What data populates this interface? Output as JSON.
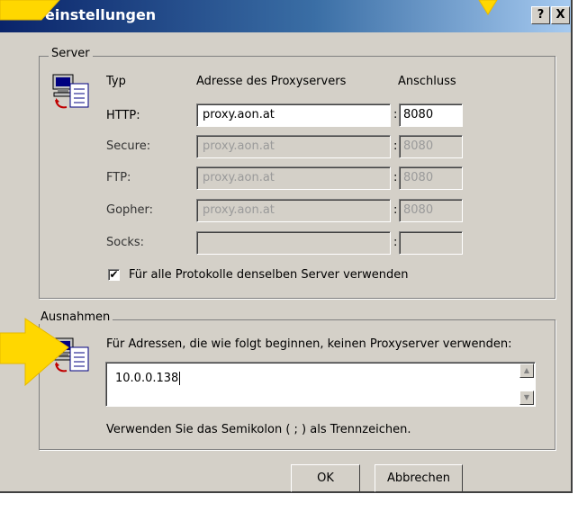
{
  "title": "Proxyeinstellungen",
  "title_visible": "einstellungen",
  "help_button": "?",
  "close_button": "X",
  "server": {
    "legend": "Server",
    "col_typ": "Typ",
    "col_address": "Adresse des Proxyservers",
    "col_port": "Anschluss",
    "rows": [
      {
        "label": "HTTP:",
        "address": "proxy.aon.at",
        "port": "8080",
        "enabled": true
      },
      {
        "label": "Secure:",
        "address": "proxy.aon.at",
        "port": "8080",
        "enabled": false
      },
      {
        "label": "FTP:",
        "address": "proxy.aon.at",
        "port": "8080",
        "enabled": false
      },
      {
        "label": "Gopher:",
        "address": "proxy.aon.at",
        "port": "8080",
        "enabled": false
      },
      {
        "label": "Socks:",
        "address": "",
        "port": "",
        "enabled": false
      }
    ],
    "same_server_label": "Für alle Protokolle denselben Server verwenden",
    "same_server_checked": true
  },
  "exceptions": {
    "legend": "Ausnahmen",
    "instruction": "Für Adressen, die wie folgt beginnen, keinen Proxyserver verwenden:",
    "value": "10.0.0.138",
    "hint": "Verwenden Sie das Semikolon ( ; ) als Trennzeichen."
  },
  "buttons": {
    "ok": "OK",
    "cancel": "Abbrechen"
  },
  "colors": {
    "highlight_arrow": "#ffd700",
    "title_bar": "#0a246a",
    "dialog_bg": "#d4d0c8"
  }
}
